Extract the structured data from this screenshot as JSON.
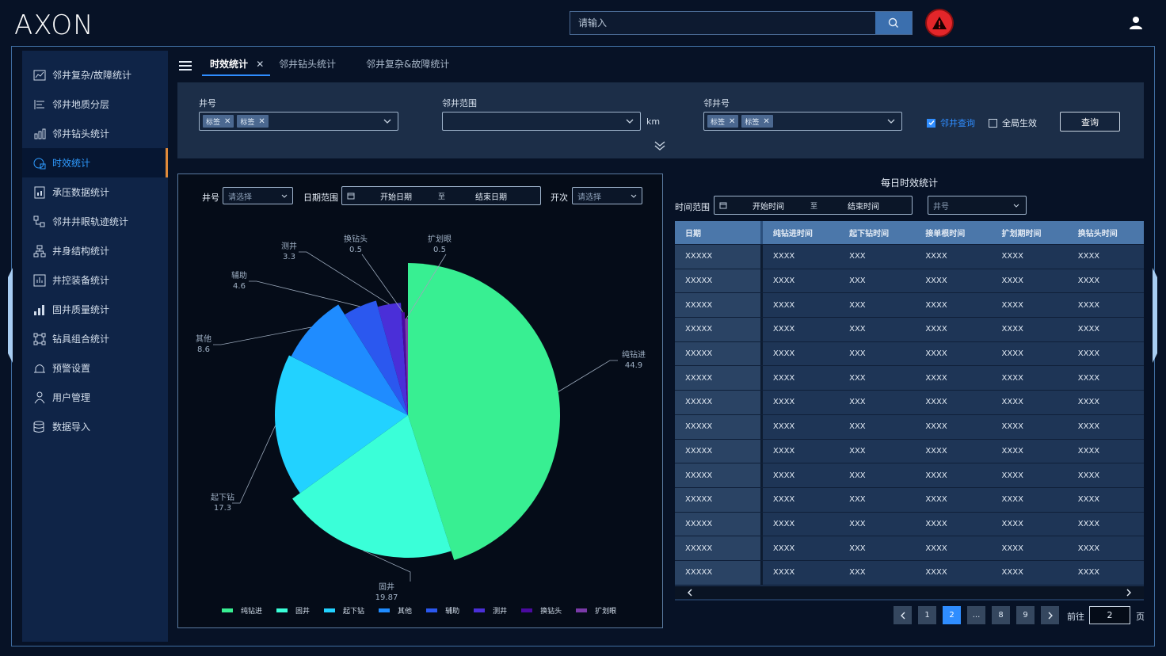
{
  "app": {
    "logo": "AXON"
  },
  "header": {
    "search_placeholder": "请输入"
  },
  "sidebar": {
    "items": [
      {
        "label": "邻井复杂/故障统计",
        "icon": "chart-icon"
      },
      {
        "label": "邻井地质分层",
        "icon": "layers-icon"
      },
      {
        "label": "邻井钻头统计",
        "icon": "bar-chart-icon"
      },
      {
        "label": "时效统计",
        "icon": "clock-icon",
        "active": true
      },
      {
        "label": "承压数据统计",
        "icon": "report-icon"
      },
      {
        "label": "邻井井眼轨迹统计",
        "icon": "trajectory-icon"
      },
      {
        "label": "井身结构统计",
        "icon": "structure-icon"
      },
      {
        "label": "井控装备统计",
        "icon": "equipment-icon"
      },
      {
        "label": "固井质量统计",
        "icon": "quality-icon"
      },
      {
        "label": "钻具组合统计",
        "icon": "assembly-icon"
      },
      {
        "label": "预警设置",
        "icon": "bell-icon"
      },
      {
        "label": "用户管理",
        "icon": "users-icon"
      },
      {
        "label": "数据导入",
        "icon": "database-icon"
      }
    ]
  },
  "tabs": [
    {
      "label": "时效统计",
      "active": true
    },
    {
      "label": "邻井钻头统计"
    },
    {
      "label": "邻井复杂&故障统计"
    }
  ],
  "filter": {
    "well_label": "井号",
    "range_label": "邻井范围",
    "adj_label": "邻井号",
    "km": "km",
    "tag1": "标签",
    "tag2": "标签",
    "tag3": "标签",
    "tag4": "标签",
    "check_adj": "邻井查询",
    "check_global": "全局生效",
    "query_btn": "查询"
  },
  "chart_panel": {
    "well_label": "井号",
    "well_placeholder": "请选择",
    "date_label": "日期范围",
    "start": "开始日期",
    "to": "至",
    "end": "结束日期",
    "kaici_label": "开次",
    "kaici_placeholder": "请选择"
  },
  "chart_data": {
    "type": "pie",
    "title": "",
    "categories": [
      "纯钻进",
      "固井",
      "起下钻",
      "其他",
      "辅助",
      "测井",
      "换钻头",
      "扩划眼"
    ],
    "values": [
      44.9,
      19.87,
      17.3,
      8.6,
      4.6,
      3.3,
      0.5,
      0.5
    ],
    "value_labels": [
      "44.9",
      "19.87",
      "17.3",
      "8.6",
      "4.6",
      "3.3",
      "0.5",
      "0.5"
    ],
    "colors": [
      "#38ef92",
      "#3affd8",
      "#22d2ff",
      "#1f8cff",
      "#2b58ef",
      "#4a2fd8",
      "#4a0aa0",
      "#7a3aa8"
    ],
    "legend_position": "bottom"
  },
  "table_panel": {
    "title": "每日时效统计",
    "time_label": "时间范围",
    "start": "开始时间",
    "to": "至",
    "end": "结束时间",
    "well_placeholder": "井号",
    "headers": [
      "日期",
      "纯钻进时间",
      "起下钻时间",
      "接单根时间",
      "扩划期时间",
      "换钻头时间"
    ],
    "rows": [
      [
        "XXXXX",
        "XXXX",
        "XXX",
        "XXXX",
        "XXXX",
        "XXXX"
      ],
      [
        "XXXXX",
        "XXXX",
        "XXX",
        "XXXX",
        "XXXX",
        "XXXX"
      ],
      [
        "XXXXX",
        "XXXX",
        "XXX",
        "XXXX",
        "XXXX",
        "XXXX"
      ],
      [
        "XXXXX",
        "XXXX",
        "XXX",
        "XXXX",
        "XXXX",
        "XXXX"
      ],
      [
        "XXXXX",
        "XXXX",
        "XXX",
        "XXXX",
        "XXXX",
        "XXXX"
      ],
      [
        "XXXXX",
        "XXXX",
        "XXX",
        "XXXX",
        "XXXX",
        "XXXX"
      ],
      [
        "XXXXX",
        "XXXX",
        "XXX",
        "XXXX",
        "XXXX",
        "XXXX"
      ],
      [
        "XXXXX",
        "XXXX",
        "XXX",
        "XXXX",
        "XXXX",
        "XXXX"
      ],
      [
        "XXXXX",
        "XXXX",
        "XXX",
        "XXXX",
        "XXXX",
        "XXXX"
      ],
      [
        "XXXXX",
        "XXXX",
        "XXX",
        "XXXX",
        "XXXX",
        "XXXX"
      ],
      [
        "XXXXX",
        "XXXX",
        "XXX",
        "XXXX",
        "XXXX",
        "XXXX"
      ],
      [
        "XXXXX",
        "XXXX",
        "XXX",
        "XXXX",
        "XXXX",
        "XXXX"
      ],
      [
        "XXXXX",
        "XXXX",
        "XXX",
        "XXXX",
        "XXXX",
        "XXXX"
      ],
      [
        "XXXXX",
        "XXXX",
        "XXX",
        "XXXX",
        "XXXX",
        "XXXX"
      ]
    ]
  },
  "pager": {
    "pages": [
      "1",
      "2",
      "...",
      "8",
      "9"
    ],
    "current": "2",
    "goto_label": "前往",
    "goto_value": "2",
    "page_unit": "页"
  }
}
